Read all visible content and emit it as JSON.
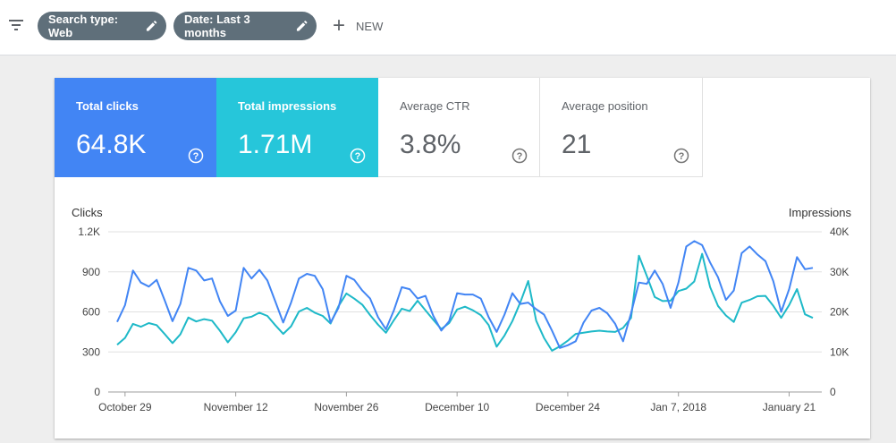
{
  "toolbar": {
    "filter_icon": "filter-list-icon",
    "chips": [
      {
        "label": "Search type: Web"
      },
      {
        "label": "Date: Last 3 months"
      }
    ],
    "new_label": "NEW"
  },
  "metrics": [
    {
      "label": "Total clicks",
      "value": "64.8K",
      "color": "#4285f4"
    },
    {
      "label": "Total impressions",
      "value": "1.71M",
      "color": "#26c6da"
    },
    {
      "label": "Average CTR",
      "value": "3.8%"
    },
    {
      "label": "Average position",
      "value": "21"
    }
  ],
  "chart_data": {
    "type": "line",
    "left_axis": {
      "label": "Clicks",
      "ticks": [
        "0",
        "300",
        "600",
        "900",
        "1.2K"
      ],
      "ylim": [
        0,
        1200
      ]
    },
    "right_axis": {
      "label": "Impressions",
      "ticks": [
        "0",
        "10K",
        "20K",
        "30K",
        "40K"
      ],
      "ylim": [
        0,
        40000
      ]
    },
    "x_ticks": [
      {
        "label": "October 29",
        "index": 1
      },
      {
        "label": "November 12",
        "index": 15
      },
      {
        "label": "November 26",
        "index": 29
      },
      {
        "label": "December 10",
        "index": 43
      },
      {
        "label": "December 24",
        "index": 57
      },
      {
        "label": "Jan 7, 2018",
        "index": 71
      },
      {
        "label": "January 21",
        "index": 85
      }
    ],
    "grid": true,
    "series": [
      {
        "name": "Clicks",
        "axis": "left",
        "color": "#4285f4",
        "values": [
          525,
          650,
          910,
          820,
          790,
          840,
          690,
          530,
          660,
          930,
          910,
          835,
          850,
          680,
          570,
          610,
          930,
          850,
          915,
          835,
          680,
          520,
          670,
          850,
          885,
          870,
          770,
          520,
          630,
          870,
          840,
          760,
          700,
          560,
          470,
          610,
          785,
          770,
          700,
          720,
          570,
          460,
          530,
          740,
          730,
          730,
          700,
          560,
          450,
          580,
          740,
          660,
          670,
          620,
          580,
          460,
          330,
          350,
          380,
          520,
          610,
          630,
          590,
          510,
          380,
          590,
          820,
          810,
          910,
          810,
          630,
          820,
          1090,
          1130,
          1100,
          970,
          860,
          690,
          760,
          1040,
          1090,
          1030,
          980,
          830,
          600,
          770,
          1010,
          920,
          930
        ]
      },
      {
        "name": "Impressions",
        "axis": "right",
        "values": [
          11800,
          13500,
          17000,
          16300,
          17200,
          16700,
          14500,
          12200,
          14400,
          18600,
          17600,
          18200,
          17800,
          15300,
          12400,
          14900,
          18400,
          18800,
          19800,
          19000,
          16700,
          14500,
          16400,
          20100,
          21000,
          19800,
          19000,
          17100,
          21400,
          24600,
          23300,
          21800,
          19200,
          16800,
          14800,
          17900,
          20800,
          20200,
          22800,
          20400,
          18000,
          15700,
          17200,
          20600,
          21300,
          20400,
          19200,
          16700,
          11300,
          14100,
          17700,
          22400,
          27700,
          17800,
          13500,
          10300,
          11400,
          12800,
          14500,
          14800,
          15100,
          15300,
          15100,
          15000,
          16000,
          18500,
          34000,
          29000,
          23700,
          22700,
          22800,
          25200,
          25800,
          27600,
          34500,
          26200,
          21500,
          19100,
          17500,
          22300,
          23000,
          23900,
          24000,
          21500,
          18500,
          21700,
          25700,
          19400,
          18500
        ],
        "color": "#1eb9c8"
      }
    ]
  }
}
